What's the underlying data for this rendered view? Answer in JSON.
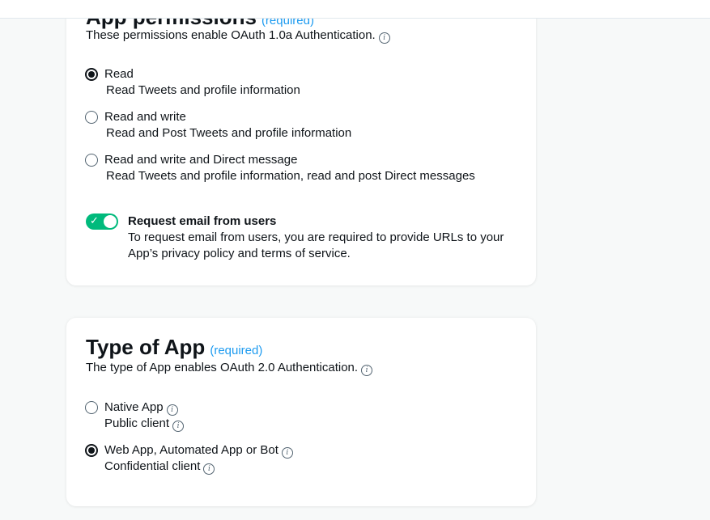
{
  "permissions": {
    "title": "App permissions",
    "required_label": "(required)",
    "description": "These permissions enable OAuth 1.0a Authentication.",
    "options": [
      {
        "label": "Read",
        "sublabel": "Read Tweets and profile information",
        "selected": true
      },
      {
        "label": "Read and write",
        "sublabel": "Read and Post Tweets and profile information",
        "selected": false
      },
      {
        "label": "Read and write and Direct message",
        "sublabel": "Read Tweets and profile information, read and post Direct messages",
        "selected": false
      }
    ],
    "email_toggle": {
      "label": "Request email from users",
      "description": "To request email from users, you are required to provide URLs to your App’s privacy policy and terms of service.",
      "enabled": true
    }
  },
  "app_type": {
    "title": "Type of App",
    "required_label": "(required)",
    "description": "The type of App enables OAuth 2.0 Authentication.",
    "options": [
      {
        "label": "Native App",
        "sublabel": "Public client",
        "selected": false
      },
      {
        "label": "Web App, Automated App or Bot",
        "sublabel": "Confidential client",
        "selected": true
      }
    ]
  },
  "colors": {
    "accent": "#1d9bf0",
    "toggle_on": "#00ba7c",
    "text": "#0f1419",
    "muted": "#536471",
    "background": "#f7f9f9"
  },
  "icons": {
    "info": "info-circle-icon",
    "check": "checkmark-icon"
  }
}
